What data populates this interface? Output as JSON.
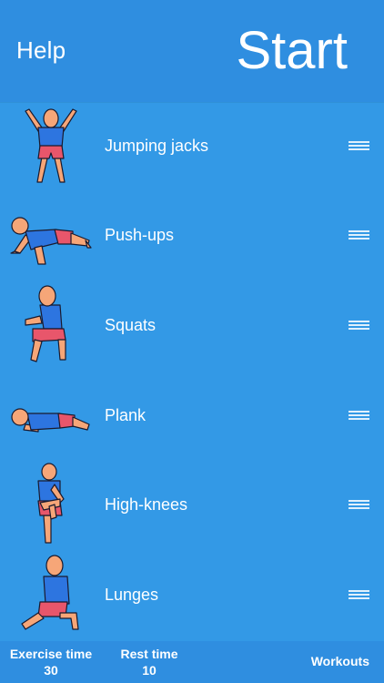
{
  "header": {
    "help_label": "Help",
    "start_label": "Start"
  },
  "exercises": [
    {
      "label": "Jumping jacks",
      "icon": "jumping-jacks-figure"
    },
    {
      "label": "Push-ups",
      "icon": "push-ups-figure"
    },
    {
      "label": "Squats",
      "icon": "squats-figure"
    },
    {
      "label": "Plank",
      "icon": "plank-figure"
    },
    {
      "label": "High-knees",
      "icon": "high-knees-figure"
    },
    {
      "label": "Lunges",
      "icon": "lunges-figure"
    }
  ],
  "footer": {
    "exercise_time_label": "Exercise time",
    "exercise_time_value": "30",
    "rest_time_label": "Rest time",
    "rest_time_value": "10",
    "workouts_label": "Workouts"
  },
  "colors": {
    "background": "#3399e6",
    "header": "#2f8ee0",
    "skin": "#f6a678",
    "shirt": "#2d75e0",
    "shorts": "#e8566b",
    "outline": "#1a1a2e"
  }
}
